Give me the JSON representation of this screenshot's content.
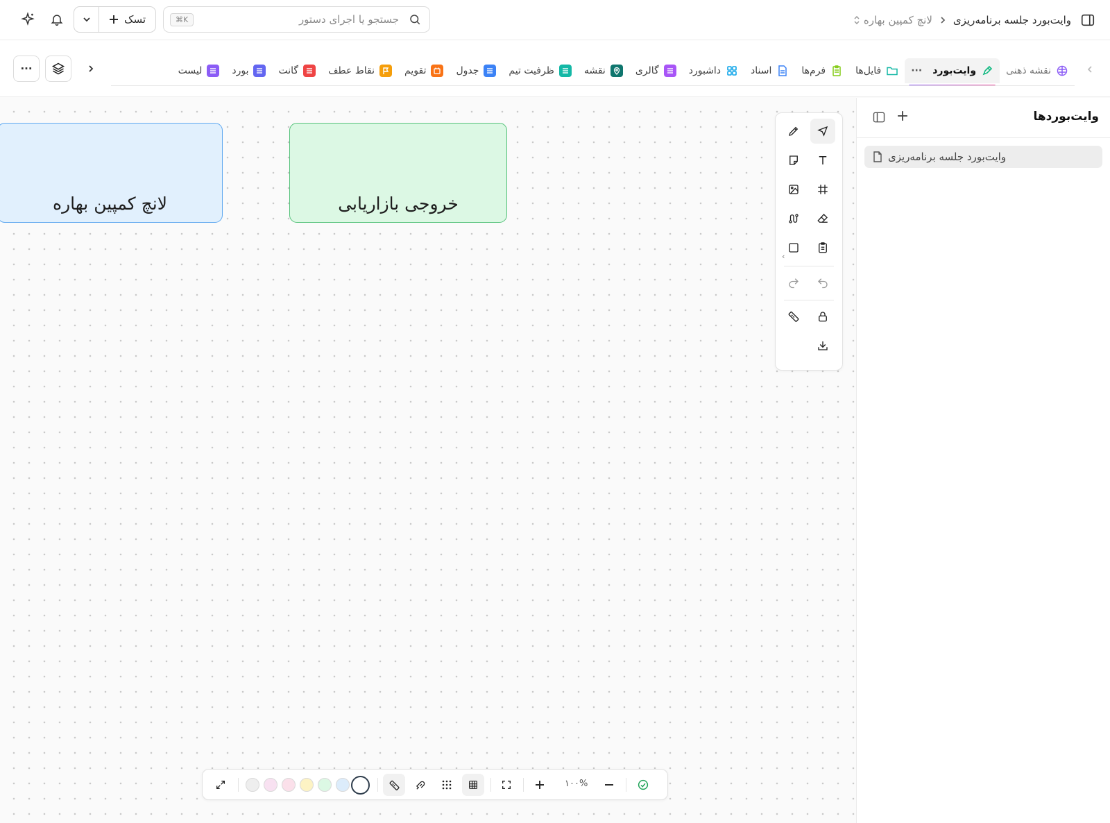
{
  "header": {
    "project_name": "لانچ کمپین بهاره",
    "page_name": "وایت‌بورد جلسه برنامه‌ریزی",
    "search_placeholder": "جستجو یا اجرای دستور",
    "search_shortcut": "⌘K",
    "task_button_label": "تسک",
    "icons": [
      "panel-toggle-icon",
      "chevron-left-icon",
      "search-icon",
      "chevron-down-icon",
      "plus-icon",
      "bell-icon",
      "sparkle-icon"
    ]
  },
  "tabs": [
    {
      "label": "لیست",
      "icon": "list-icon",
      "color": "#8b5cf6"
    },
    {
      "label": "بورد",
      "icon": "board-icon",
      "color": "#6366f1"
    },
    {
      "label": "گانت",
      "icon": "gantt-icon",
      "color": "#ef4444"
    },
    {
      "label": "نقاط عطف",
      "icon": "flag-icon",
      "color": "#f59e0b"
    },
    {
      "label": "تقویم",
      "icon": "calendar-icon",
      "color": "#f97316"
    },
    {
      "label": "جدول",
      "icon": "table-icon",
      "color": "#3b82f6"
    },
    {
      "label": "ظرفیت تیم",
      "icon": "capacity-icon",
      "color": "#14b8a6"
    },
    {
      "label": "نقشه",
      "icon": "map-pin-icon",
      "color": "#0f766e"
    },
    {
      "label": "گالری",
      "icon": "gallery-icon",
      "color": "#a855f7"
    },
    {
      "label": "داشبورد",
      "icon": "dashboard-icon",
      "color": "#0ea5e9"
    },
    {
      "label": "اسناد",
      "icon": "doc-icon",
      "color": "#3b82f6"
    },
    {
      "label": "فرم‌ها",
      "icon": "form-icon",
      "color": "#84cc16"
    },
    {
      "label": "فایل‌ها",
      "icon": "folder-icon",
      "color": "#14b8a6"
    },
    {
      "label": "وایت‌بورد",
      "icon": "whiteboard-icon",
      "color": "#10b981",
      "active": true,
      "more": "···"
    },
    {
      "label": "نقشه ذهنی",
      "icon": "mindmap-icon",
      "color": "#8b5cf6"
    }
  ],
  "tabbar": {
    "more_label": "···",
    "icons": [
      "chevron-left-icon",
      "chevron-right-icon",
      "layers-icon"
    ]
  },
  "canvas": {
    "notes": [
      {
        "text": "لانچ کمپین بهاره",
        "fill": "#e1f0fd",
        "border": "#5ea8f0"
      },
      {
        "text": "خروجی بازاریابی",
        "fill": "#dcf8e4",
        "border": "#55c27a"
      }
    ],
    "tools": [
      "select-icon",
      "pencil-icon",
      "text-icon",
      "sticky-note-icon",
      "frame-icon",
      "image-icon",
      "eraser-icon",
      "connector-icon",
      "clipboard-icon",
      "rectangle-icon",
      "undo-icon",
      "redo-icon",
      "lock-icon",
      "ruler-icon",
      "download-icon"
    ],
    "active_tool": "select-icon",
    "collapse_glyph": "‹"
  },
  "bottom_bar": {
    "zoom": "۱۰۰%",
    "swatches": [
      "#eeeeee",
      "#f8e1f1",
      "#fbe0ea",
      "#fdf3c4",
      "#dcf8e4",
      "#dcecfb"
    ],
    "selected_swatch": "#ffffff",
    "icons": [
      "expand-icon",
      "ruler-icon",
      "snap-icon",
      "dots-grid-icon",
      "grid-icon",
      "fit-screen-icon",
      "zoom-in-icon",
      "zoom-out-icon",
      "saved-check-icon"
    ]
  },
  "sidebar": {
    "title": "وایت‌بوردها",
    "items": [
      {
        "label": "وایت‌بورد جلسه برنامه‌ریزی",
        "icon": "file-icon"
      }
    ],
    "icons": [
      "plus-icon",
      "layout-icon"
    ]
  }
}
